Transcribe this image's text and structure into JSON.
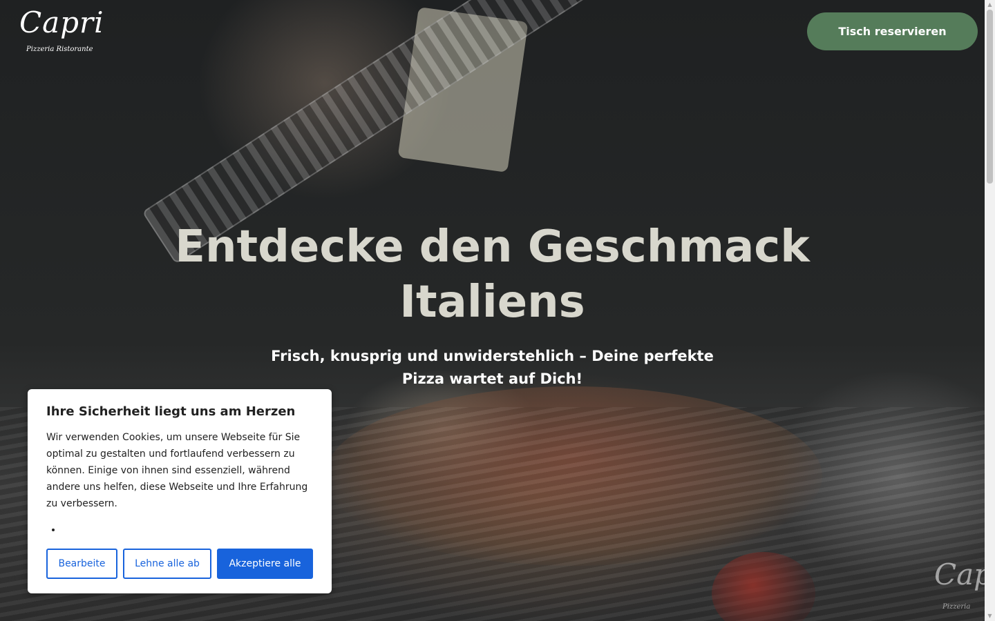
{
  "header": {
    "logo": {
      "text": "Capri",
      "subtitle": "Pizzeria  Ristorante"
    },
    "reserve_button": "Tisch reservieren"
  },
  "hero": {
    "headline": "Entdecke den Geschmack Italiens",
    "subline": "Frisch, knusprig und unwiderstehlich – Deine perfekte Pizza wartet auf Dich!"
  },
  "cookie_banner": {
    "title": "Ihre Sicherheit liegt uns am Herzen",
    "text": "Wir verwenden Cookies, um unsere Webseite für Sie optimal zu gestalten und fortlaufend verbessern zu können. Einige von ihnen sind essenziell, während andere uns helfen, diese Webseite und Ihre Erfahrung zu verbessern.",
    "list_items": [
      ""
    ],
    "buttons": {
      "customize": "Bearbeite",
      "reject": "Lehne alle ab",
      "accept": "Akzeptiere alle"
    }
  },
  "revisit_logo": {
    "text": "Capri",
    "subtitle": "Pizzeria"
  },
  "colors": {
    "reserve_button": "#557c5a",
    "accept_button": "#1863dc",
    "headline": "#d8d7cd",
    "banner_bg": "#ffffff"
  }
}
